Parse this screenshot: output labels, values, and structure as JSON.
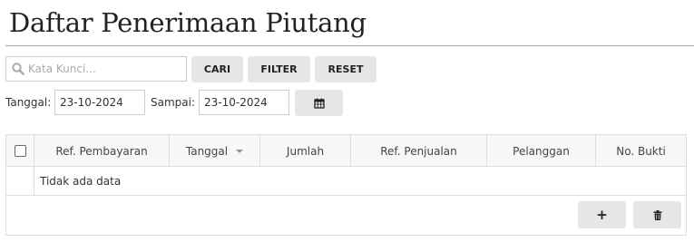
{
  "page": {
    "title": "Daftar Penerimaan Piutang"
  },
  "toolbar": {
    "search_placeholder": "Kata Kunci...",
    "search_value": "",
    "search_label": "CARI",
    "filter_label": "FILTER",
    "reset_label": "RESET"
  },
  "date_filter": {
    "from_label": "Tanggal:",
    "from_value": "23-10-2024",
    "to_label": "Sampai:",
    "to_value": "23-10-2024"
  },
  "grid": {
    "columns": [
      "Ref. Pembayaran",
      "Tanggal",
      "Jumlah",
      "Ref. Penjualan",
      "Pelanggan",
      "No. Bukti"
    ],
    "empty_text": "Tidak ada data",
    "add_symbol": "+"
  },
  "icons": {
    "search": "search-icon",
    "calendar": "calendar-icon",
    "sort": "sort-desc-icon",
    "trash": "trash-icon"
  }
}
